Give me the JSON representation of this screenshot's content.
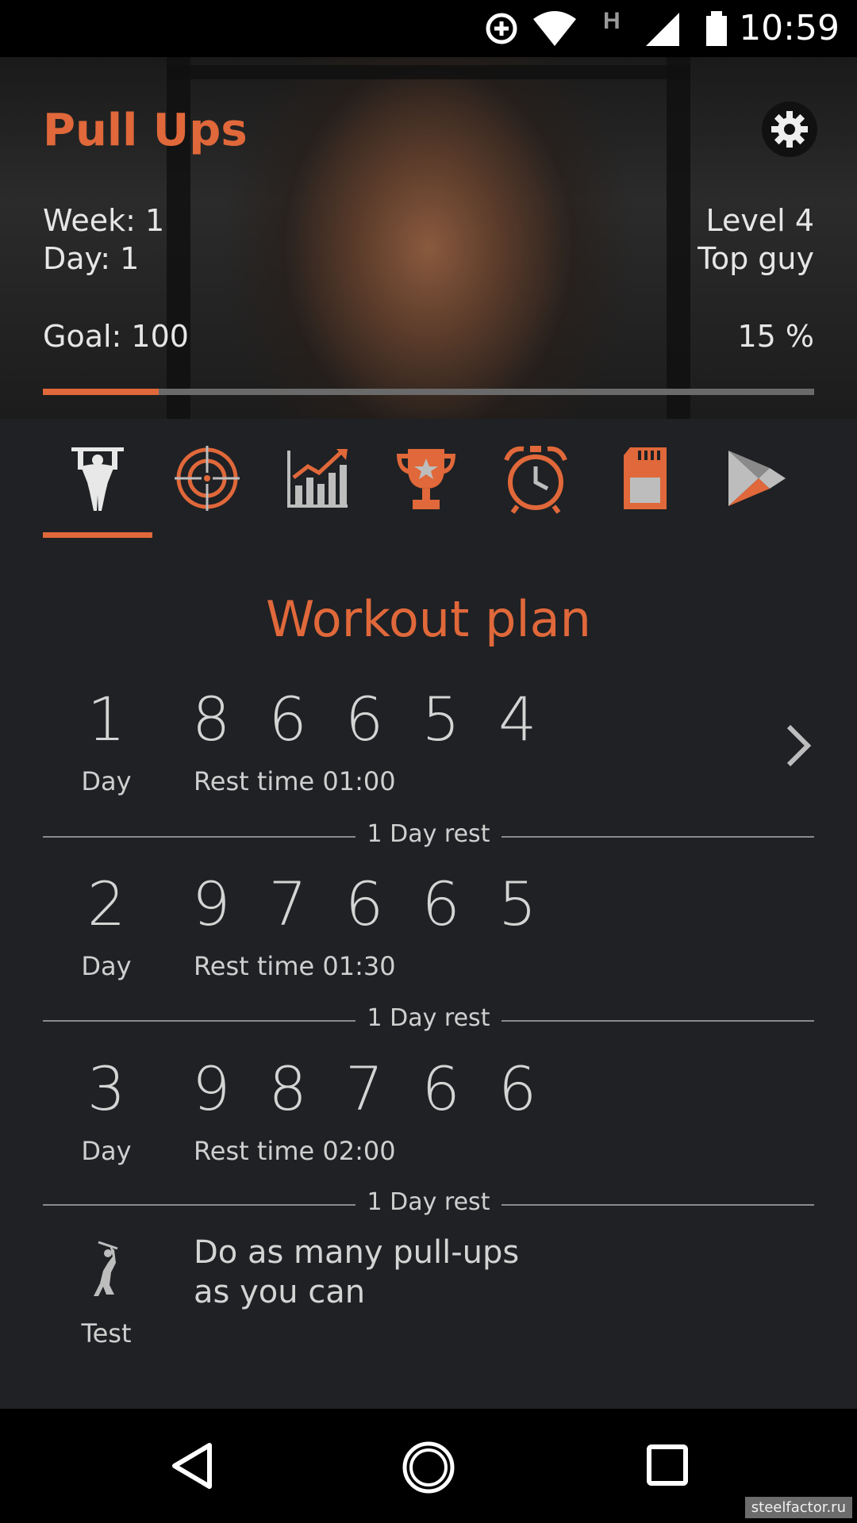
{
  "status_bar": {
    "time": "10:59",
    "icons": [
      "data-saver-icon",
      "wifi-icon",
      "h-network-icon",
      "signal-icon",
      "battery-icon"
    ],
    "network_type": "H"
  },
  "header": {
    "title": "Pull Ups",
    "week": "Week: 1",
    "day": "Day: 1",
    "level": "Level 4",
    "rank": "Top guy",
    "goal": "Goal: 100",
    "percent": "15 %",
    "progress_fraction": 0.15
  },
  "tabs": [
    {
      "icon": "athlete-icon",
      "active": true
    },
    {
      "icon": "target-icon",
      "active": false
    },
    {
      "icon": "chart-icon",
      "active": false
    },
    {
      "icon": "trophy-icon",
      "active": false
    },
    {
      "icon": "alarm-clock-icon",
      "active": false
    },
    {
      "icon": "sd-card-icon",
      "active": false
    },
    {
      "icon": "play-store-icon",
      "active": false
    }
  ],
  "plan": {
    "title": "Workout plan",
    "days": [
      {
        "number": "1",
        "label": "Day",
        "reps": "8 6 6 5 4",
        "rest": "Rest time 01:00"
      },
      {
        "number": "2",
        "label": "Day",
        "reps": "9 7 6 6 5",
        "rest": "Rest time 01:30"
      },
      {
        "number": "3",
        "label": "Day",
        "reps": "9 8 7 6 6",
        "rest": "Rest time 02:00"
      }
    ],
    "rest_label": "1 Day rest",
    "test": {
      "label": "Test",
      "text_line1": "Do as many pull-ups",
      "text_line2": "as you can"
    }
  },
  "watermark": "steelfactor.ru",
  "colors": {
    "accent": "#e0683a",
    "background": "#1f2124"
  }
}
